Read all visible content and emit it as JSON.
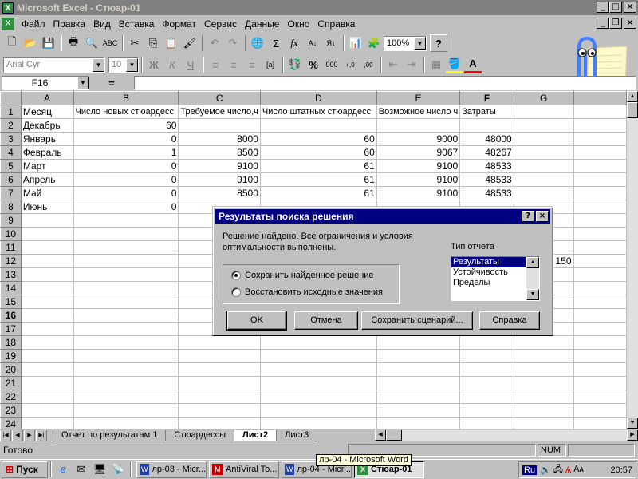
{
  "window": {
    "title": "Microsoft Excel - Стюар-01",
    "app_icon": "excel-icon"
  },
  "menu": [
    "Файл",
    "Правка",
    "Вид",
    "Вставка",
    "Формат",
    "Сервис",
    "Данные",
    "Окно",
    "Справка"
  ],
  "menu_accel": [
    "Ф",
    "П",
    "В",
    "с",
    "о",
    "С",
    "Д",
    "О",
    "С"
  ],
  "toolbar": {
    "zoom": "100%",
    "font_name": "Arial Cyr",
    "font_size": "10",
    "bold": "Ж",
    "italic": "К",
    "underline": "Ч",
    "percent": "%",
    "thousands": "000",
    "decimal_inc": "+,0",
    "decimal_dec": ",00",
    "sigma": "Σ",
    "fx": "fx",
    "help": "?"
  },
  "formula_bar": {
    "name_box": "F16",
    "equals": "=",
    "formula": ""
  },
  "columns": [
    "A",
    "B",
    "C",
    "D",
    "E",
    "F",
    "G"
  ],
  "rows": [
    {
      "n": "1",
      "cells": [
        "Месяц",
        "Число новых стюардесс",
        "Требуемое число,ч",
        "Число штатных стюардесс",
        "Возможное число ч",
        "Затраты",
        ""
      ]
    },
    {
      "n": "2",
      "cells": [
        "Декабрь",
        "60",
        "",
        "",
        "",
        "",
        ""
      ]
    },
    {
      "n": "3",
      "cells": [
        "Январь",
        "0",
        "8000",
        "60",
        "9000",
        "48000",
        ""
      ]
    },
    {
      "n": "4",
      "cells": [
        "Февраль",
        "1",
        "8500",
        "60",
        "9067",
        "48267",
        ""
      ]
    },
    {
      "n": "5",
      "cells": [
        "Март",
        "0",
        "9100",
        "61",
        "9100",
        "48533",
        ""
      ]
    },
    {
      "n": "6",
      "cells": [
        "Апрель",
        "0",
        "9100",
        "61",
        "9100",
        "48533",
        ""
      ]
    },
    {
      "n": "7",
      "cells": [
        "Май",
        "0",
        "8500",
        "61",
        "9100",
        "48533",
        ""
      ]
    },
    {
      "n": "8",
      "cells": [
        "Июнь",
        "0",
        "",
        "",
        "",
        "",
        ""
      ]
    },
    {
      "n": "9",
      "cells": [
        "",
        "",
        "",
        "",
        "",
        "",
        ""
      ]
    },
    {
      "n": "10",
      "cells": [
        "",
        "",
        "",
        "",
        "",
        "",
        ""
      ]
    },
    {
      "n": "11",
      "cells": [
        "",
        "",
        "",
        "",
        "",
        "",
        ""
      ]
    },
    {
      "n": "12",
      "cells": [
        "",
        "",
        "",
        "",
        "",
        "",
        "150"
      ]
    },
    {
      "n": "13",
      "cells": [
        "",
        "",
        "",
        "",
        "",
        "",
        ""
      ]
    },
    {
      "n": "14",
      "cells": [
        "",
        "",
        "",
        "",
        "",
        "",
        ""
      ]
    },
    {
      "n": "15",
      "cells": [
        "",
        "",
        "",
        "",
        "",
        "",
        ""
      ]
    },
    {
      "n": "16",
      "cells": [
        "",
        "",
        "",
        "",
        "",
        "",
        ""
      ]
    },
    {
      "n": "17",
      "cells": [
        "",
        "",
        "",
        "",
        "",
        "",
        ""
      ]
    },
    {
      "n": "18",
      "cells": [
        "",
        "",
        "",
        "",
        "",
        "",
        ""
      ]
    },
    {
      "n": "19",
      "cells": [
        "",
        "",
        "",
        "",
        "",
        "",
        ""
      ]
    },
    {
      "n": "20",
      "cells": [
        "",
        "",
        "",
        "",
        "",
        "",
        ""
      ]
    },
    {
      "n": "21",
      "cells": [
        "",
        "",
        "",
        "",
        "",
        "",
        ""
      ]
    },
    {
      "n": "22",
      "cells": [
        "",
        "",
        "",
        "",
        "",
        "",
        ""
      ]
    },
    {
      "n": "23",
      "cells": [
        "",
        "",
        "",
        "",
        "",
        "",
        ""
      ]
    },
    {
      "n": "24",
      "cells": [
        "",
        "",
        "",
        "",
        "",
        "",
        ""
      ]
    }
  ],
  "selected_row": "16",
  "selected_col": "F",
  "sheet_tabs": [
    "Отчет по результатам 1",
    "Стюардессы",
    "Лист2",
    "Лист3"
  ],
  "active_sheet": "Лист2",
  "status": {
    "text": "Готово",
    "num": "NUM"
  },
  "dialog": {
    "title": "Результаты поиска решения",
    "message": "Решение найдено. Все ограничения и условия оптимальности выполнены.",
    "radio_keep": "Сохранить найденное решение",
    "radio_restore": "Восстановить исходные значения",
    "report_type_label": "Тип отчета",
    "report_types": [
      "Результаты",
      "Устойчивость",
      "Пределы"
    ],
    "selected_report": "Результаты",
    "ok": "OK",
    "cancel": "Отмена",
    "save_scenario": "Сохранить сценарий...",
    "help": "Справка"
  },
  "taskbar": {
    "start": "Пуск",
    "tasks": [
      "лр-03 - Micr...",
      "AntiViral To...",
      "лр-04 - Micr...",
      "Стюар-01"
    ],
    "active_task": "Стюар-01",
    "tooltip": "лр-04 - Microsoft Word",
    "lang": "Ru",
    "clock": "20:57"
  },
  "colors": {
    "title_inactive": "#808080",
    "dialog_title": "#000080",
    "selection": "#000080",
    "face": "#c0c0c0"
  }
}
